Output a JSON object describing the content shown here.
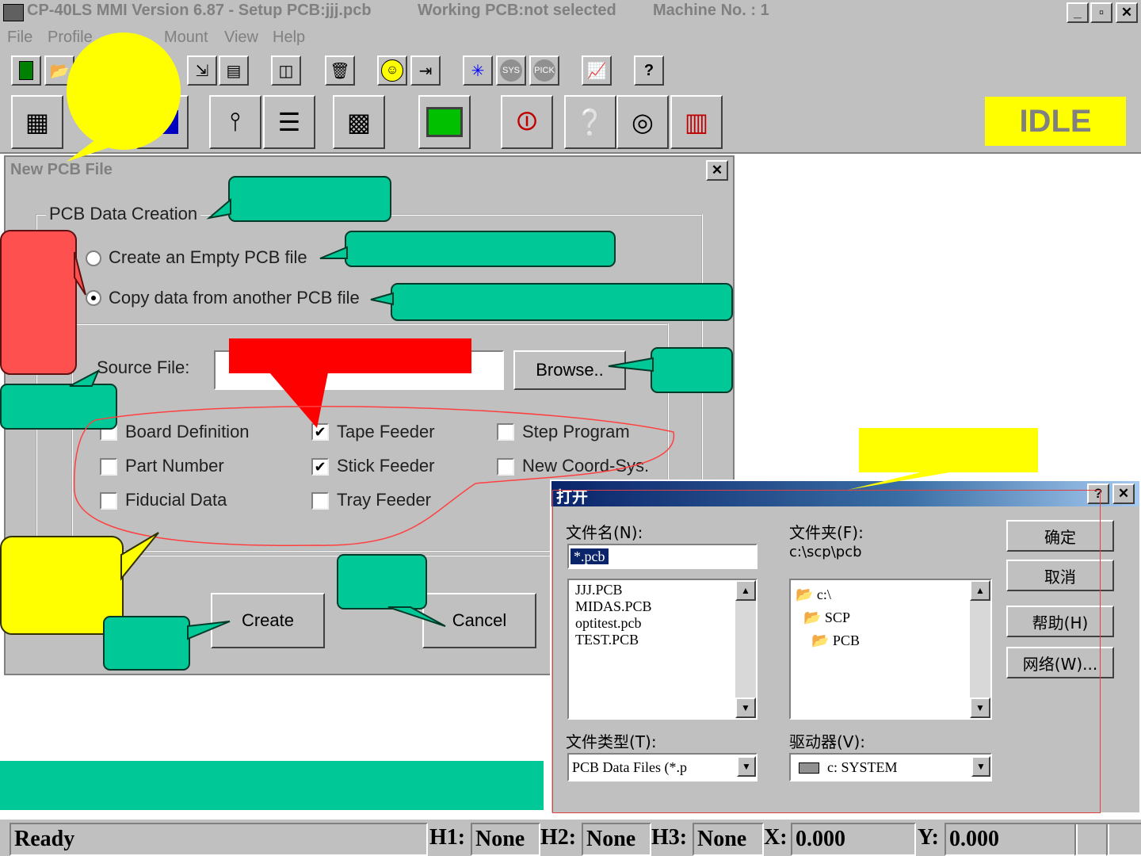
{
  "window": {
    "title": "CP-40LS MMI Version 6.87 - Setup PCB:jjj.pcb",
    "working_pcb": "Working PCB:not selected",
    "machine_no": "Machine No. : 1",
    "min_glyph": "_",
    "max_glyph": "▫",
    "close_glyph": "✕"
  },
  "menu": {
    "file": "File",
    "profile": "Profile",
    "mount": "Mount",
    "view": "View",
    "help": "Help"
  },
  "status_idle": "IDLE",
  "new_pcb_dialog": {
    "title": "New PCB File",
    "close_glyph": "✕",
    "group_label": "PCB Data Creation",
    "radio_empty": "Create an Empty PCB file",
    "radio_copy": "Copy data from another PCB file",
    "source_label": "Source File:",
    "source_value": "",
    "browse": "Browse..",
    "checks": {
      "board_definition": "Board Definition",
      "part_number": "Part Number",
      "fiducial_data": "Fiducial Data",
      "tape_feeder": "Tape Feeder",
      "stick_feeder": "Stick Feeder",
      "tray_feeder": "Tray Feeder",
      "step_program": "Step Program",
      "new_coord_sys": "New Coord-Sys."
    },
    "check_glyph": "✔",
    "create": "Create",
    "cancel": "Cancel"
  },
  "open_dialog": {
    "title": "打开",
    "help_glyph": "?",
    "close_glyph": "✕",
    "filename_label": "文件名(N):",
    "filename_value": "*.pcb",
    "folder_label": "文件夹(F):",
    "folder_path": "c:\\scp\\pcb",
    "files": [
      "JJJ.PCB",
      "MIDAS.PCB",
      "optitest.pcb",
      "TEST.PCB"
    ],
    "folders": [
      "c:\\",
      "SCP",
      "PCB"
    ],
    "filetype_label": "文件类型(T):",
    "filetype_value": "PCB Data Files (*.p",
    "drive_label": "驱动器(V):",
    "drive_value": "c: SYSTEM",
    "ok": "确定",
    "cancel": "取消",
    "help": "帮助(H)",
    "network": "网络(W)...",
    "arrow_up": "▲",
    "arrow_down": "▼"
  },
  "status_bar": {
    "ready": "Ready",
    "h1_label": "H1:",
    "h1_value": "None",
    "h2_label": "H2:",
    "h2_value": "None",
    "h3_label": "H3:",
    "h3_value": "None",
    "x_label": "X:",
    "x_value": "0.000",
    "y_label": "Y:",
    "y_value": "0.000"
  },
  "toolbar_icons": [
    "new-file-icon",
    "open-folder-icon",
    "save-icon",
    "copy-icon",
    "export-icon",
    "print-icon",
    "compare-icon",
    "trash-icon",
    "smiley-icon",
    "run-icon",
    "crosshair-icon",
    "sys-icon",
    "pick-icon",
    "chart-icon",
    "help-icon"
  ],
  "big_toolbar_icons": [
    "chip-board-icon",
    "placement-head-icon",
    "nozzle-icon",
    "feeder-icon",
    "calculator-icon",
    "monitor-icon",
    "io-switch-icon",
    "box-help-icon",
    "reel-help-icon",
    "bar-chart-icon"
  ],
  "colors": {
    "highlight_yellow": "#ffff00",
    "teal_callout": "#00c896",
    "red_callout": "#ff5050",
    "red_box": "#ff0000",
    "title_blue": "#0a246a"
  }
}
